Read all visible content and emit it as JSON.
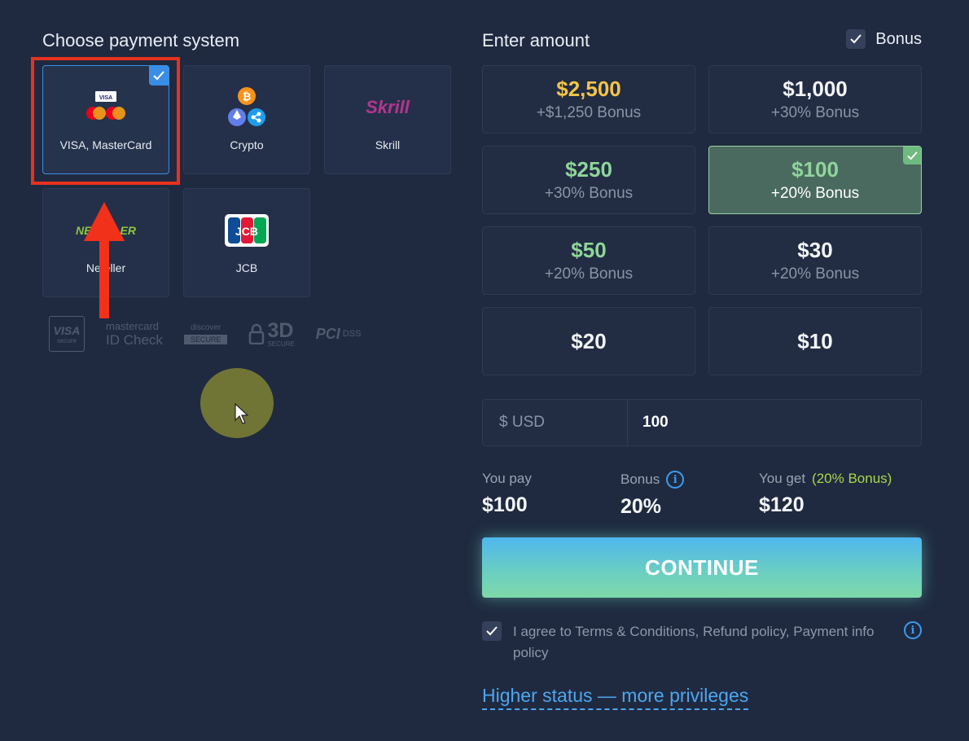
{
  "payment": {
    "title": "Choose payment system",
    "methods": [
      {
        "label": "VISA, MasterCard",
        "selected": true
      },
      {
        "label": "Crypto",
        "selected": false
      },
      {
        "label": "Skrill",
        "selected": false
      },
      {
        "label": "Neteller",
        "selected": false
      },
      {
        "label": "JCB",
        "selected": false
      }
    ],
    "logo_text": {
      "visa_small": "VISA",
      "skrill": "Skrill",
      "neteller": "NETELLER",
      "jcb": "JCB"
    },
    "badges": {
      "visa": "VISA",
      "visa_sub": "secure",
      "mastercard": "mastercard",
      "mastercard_sub": "ID Check",
      "discover": "discover",
      "discover_sub": "SECURE",
      "threed": "3D",
      "threed_sub": "SECURE",
      "pci": "PCI",
      "pci_sub": "DSS"
    }
  },
  "amount": {
    "title": "Enter amount",
    "bonus_toggle": {
      "label": "Bonus",
      "checked": true
    },
    "options": [
      {
        "amount": "$2,500",
        "bonus": "+$1,250 Bonus",
        "color": "#f2c549"
      },
      {
        "amount": "$1,000",
        "bonus": "+30% Bonus",
        "color": "#f3f5f9"
      },
      {
        "amount": "$250",
        "bonus": "+30% Bonus",
        "color": "#8fd59a"
      },
      {
        "amount": "$100",
        "bonus": "+20% Bonus",
        "color": "#8fd59a",
        "selected": true
      },
      {
        "amount": "$50",
        "bonus": "+20% Bonus",
        "color": "#8fd59a"
      },
      {
        "amount": "$30",
        "bonus": "+20% Bonus",
        "color": "#f3f5f9"
      },
      {
        "amount": "$20",
        "bonus": "",
        "color": "#f3f5f9"
      },
      {
        "amount": "$10",
        "bonus": "",
        "color": "#f3f5f9"
      }
    ],
    "currency_label": "$ USD",
    "input_value": "100"
  },
  "summary": {
    "you_pay_label": "You pay",
    "you_pay_value": "$100",
    "bonus_label": "Bonus",
    "bonus_value": "20%",
    "you_get_label": "You get",
    "you_get_bonus": "(20% Bonus)",
    "you_get_value": "$120"
  },
  "continue_label": "CONTINUE",
  "agree": {
    "checked": true,
    "text": "I agree to Terms & Conditions, Refund policy, Payment info policy"
  },
  "status_link": "Higher status — more privileges",
  "colors": {
    "background": "#1f2a40",
    "accent_blue": "#3a8ee6",
    "highlight_red": "#e8321e",
    "selected_green": "#4a6a5f"
  }
}
